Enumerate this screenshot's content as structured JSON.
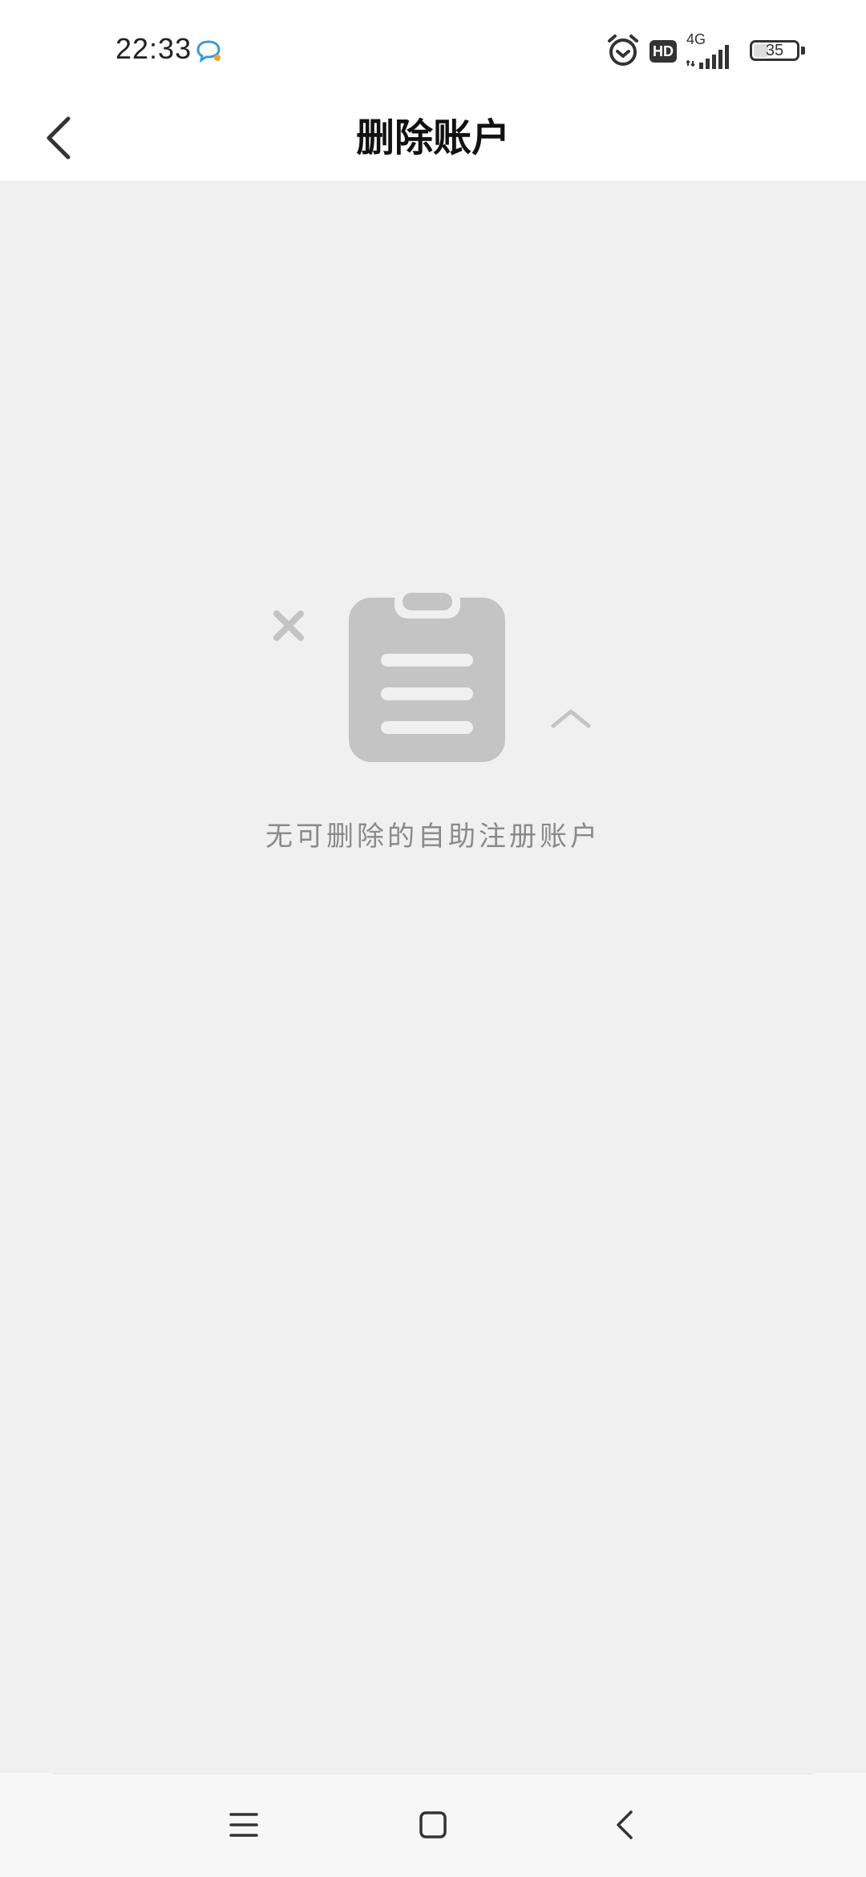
{
  "status_bar": {
    "time": "22:33",
    "network": "4G",
    "hd_label": "HD",
    "battery_percent": 35,
    "battery_text": "35",
    "icons": [
      "message-icon",
      "alarm-icon",
      "hd-icon",
      "signal-icon",
      "battery-icon"
    ]
  },
  "header": {
    "title": "删除账户",
    "back_icon": "chevron-left-icon"
  },
  "empty_state": {
    "illustration_icon": "clipboard-icon",
    "message": "无可删除的自助注册账户"
  },
  "bottom_nav": {
    "buttons": [
      "menu-icon",
      "home-icon",
      "back-icon"
    ]
  },
  "colors": {
    "background": "#f0f0f0",
    "bar": "#ffffff",
    "illustration": "#c4c4c4",
    "message_text": "#8a8a8a",
    "title_text": "#111111"
  }
}
